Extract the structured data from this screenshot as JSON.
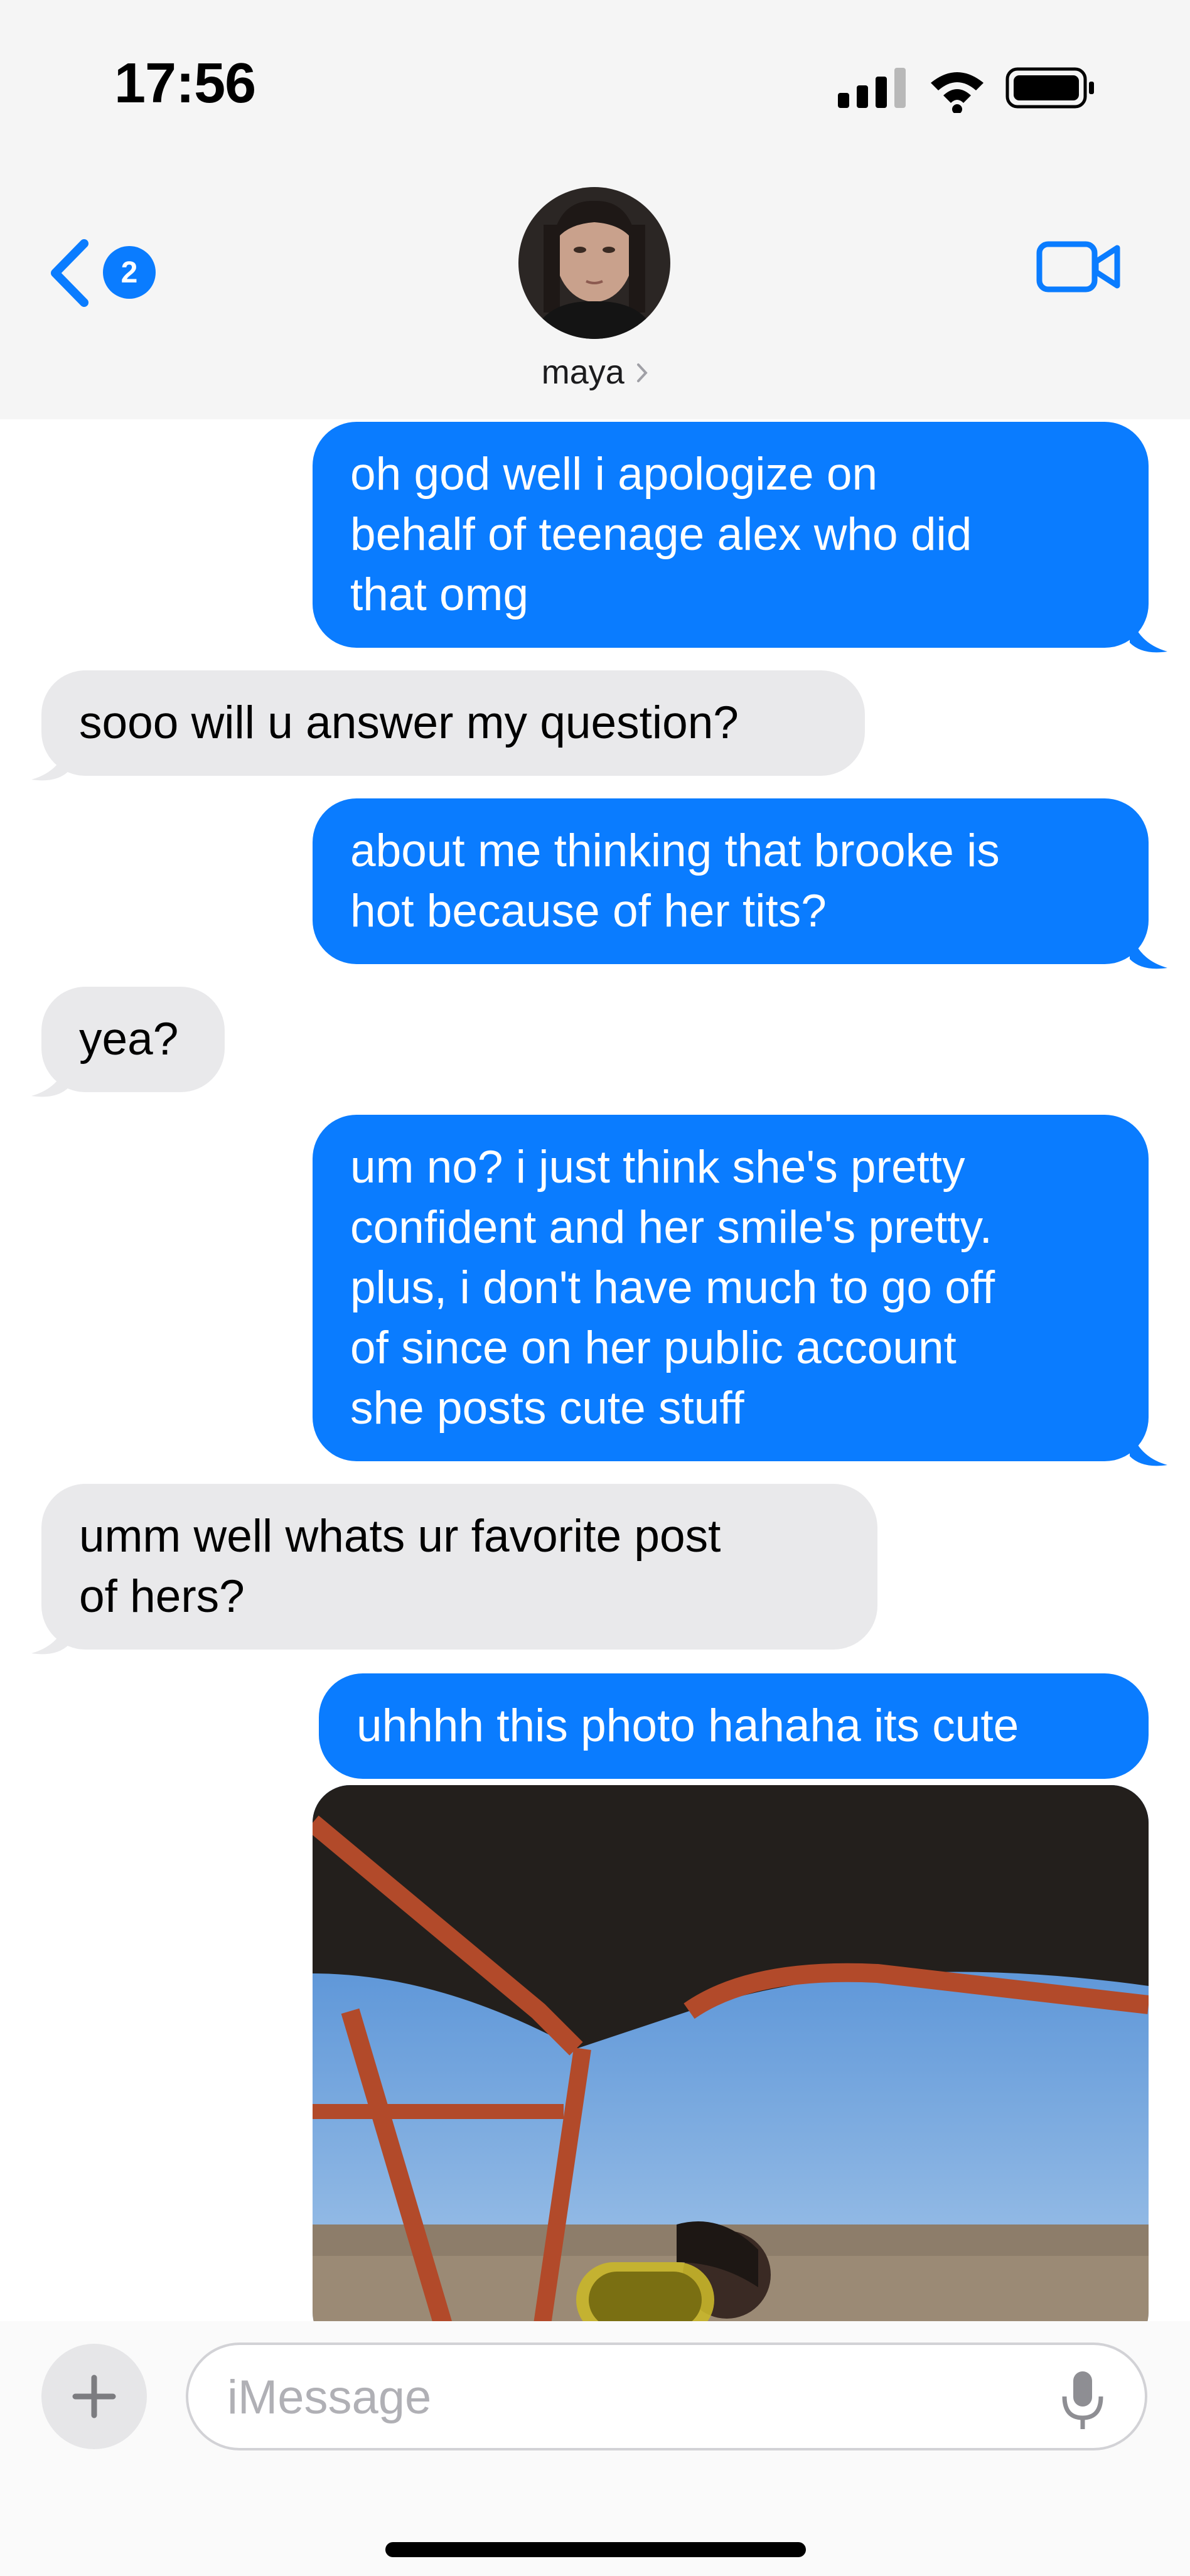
{
  "status_bar": {
    "time": "17:56"
  },
  "header": {
    "back_badge": "2",
    "contact_name": "maya"
  },
  "messages": [
    {
      "dir": "out",
      "text_lines": [
        "oh god well i apologize on",
        "behalf of teenage alex who did",
        "that omg"
      ]
    },
    {
      "dir": "in",
      "text_lines": [
        "sooo will u answer my question?"
      ]
    },
    {
      "dir": "out",
      "text_lines": [
        "about me thinking that brooke is",
        "hot because of her tits?"
      ]
    },
    {
      "dir": "in",
      "text_lines": [
        "yea?"
      ]
    },
    {
      "dir": "out",
      "text_lines": [
        "um no? i just think she's pretty",
        "confident and her smile's pretty.",
        "plus, i don't have much to go off",
        "of since on her public account",
        "she posts cute stuff"
      ]
    },
    {
      "dir": "in",
      "text_lines": [
        "umm well whats ur favorite post",
        "of hers?"
      ]
    },
    {
      "dir": "out",
      "text_lines": [
        "uhhhh this photo hahaha its cute"
      ]
    }
  ],
  "composer": {
    "placeholder": "iMessage"
  },
  "colors": {
    "outgoing_bubble": "#0a7cff",
    "incoming_bubble": "#e9e9eb",
    "header_bg": "#f5f5f5"
  },
  "icons": [
    "signal-icon",
    "wifi-icon",
    "battery-icon",
    "back-chevron-icon",
    "video-call-icon",
    "plus-icon",
    "microphone-icon"
  ]
}
